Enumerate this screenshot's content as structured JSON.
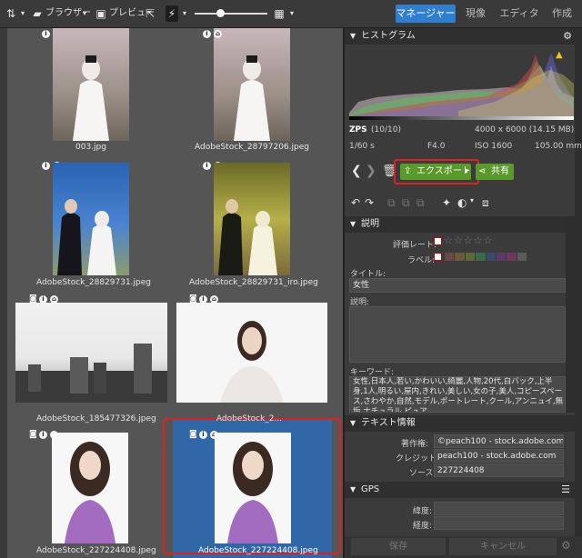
{
  "toolbar": {
    "browser_label": "ブラウザー",
    "preview_label": "プレビュー",
    "tabs": [
      "マネージャー",
      "現像",
      "エディター",
      "作成"
    ]
  },
  "thumbnails": [
    {
      "name": "003.jpg"
    },
    {
      "name": "AdobeStock_28797206.jpeg"
    },
    {
      "name": "AdobeStock_28829731.jpeg"
    },
    {
      "name": "AdobeStock_28829731_iro.jpeg"
    },
    {
      "name": "AdobeStock_185477326.jpeg"
    },
    {
      "name": "AdobeStock_2..."
    },
    {
      "name": "AdobeStock_227224408.jpeg"
    },
    {
      "name": "AdobeStock_227224408.jpeg"
    }
  ],
  "histogram": {
    "title": "ヒストグラム",
    "zps": "ZPS",
    "count": "(10/10)",
    "dimensions": "4000 x 6000 (14.15 MB)",
    "shutter": "1/60 s",
    "aperture": "F4.0",
    "iso": "ISO 1600",
    "focal": "105.00 mm"
  },
  "actions": {
    "export_label": "エクスポート",
    "share_label": "共有"
  },
  "description": {
    "title": "説明",
    "rating_label": "評価レート:",
    "label_label": "ラベル:",
    "title_label": "タイトル:",
    "title_value": "女性",
    "desc_label": "説明:",
    "keywords_label": "キーワード:",
    "keywords_value": "女性,日本人,若い,かわいい,綺麗,人物,20代,白バック,上半身,1人,明るい,屋内,きれい,美しい,女の子,美人,コピースペース,さわやか,自然,モデル,ポートレート,クール,アンニュイ,無垢,ナチュラル,ピュア,"
  },
  "text_info": {
    "title": "テキスト情報",
    "author_label": "著作権:",
    "author_value": "©peach100 - stock.adobe.com",
    "credit_label": "クレジット:",
    "credit_value": "peach100 - stock.adobe.com",
    "source_label": "ソース:",
    "source_value": "227224408"
  },
  "gps": {
    "title": "GPS",
    "lat_label": "緯度:",
    "lon_label": "経度:"
  },
  "footer": {
    "save_label": "保存",
    "cancel_label": "キャンセル"
  },
  "colors": {
    "accent": "#2f7fd1",
    "selected": "#3067a6",
    "export_green": "#5a9a2a",
    "highlight_red": "#e02020"
  }
}
